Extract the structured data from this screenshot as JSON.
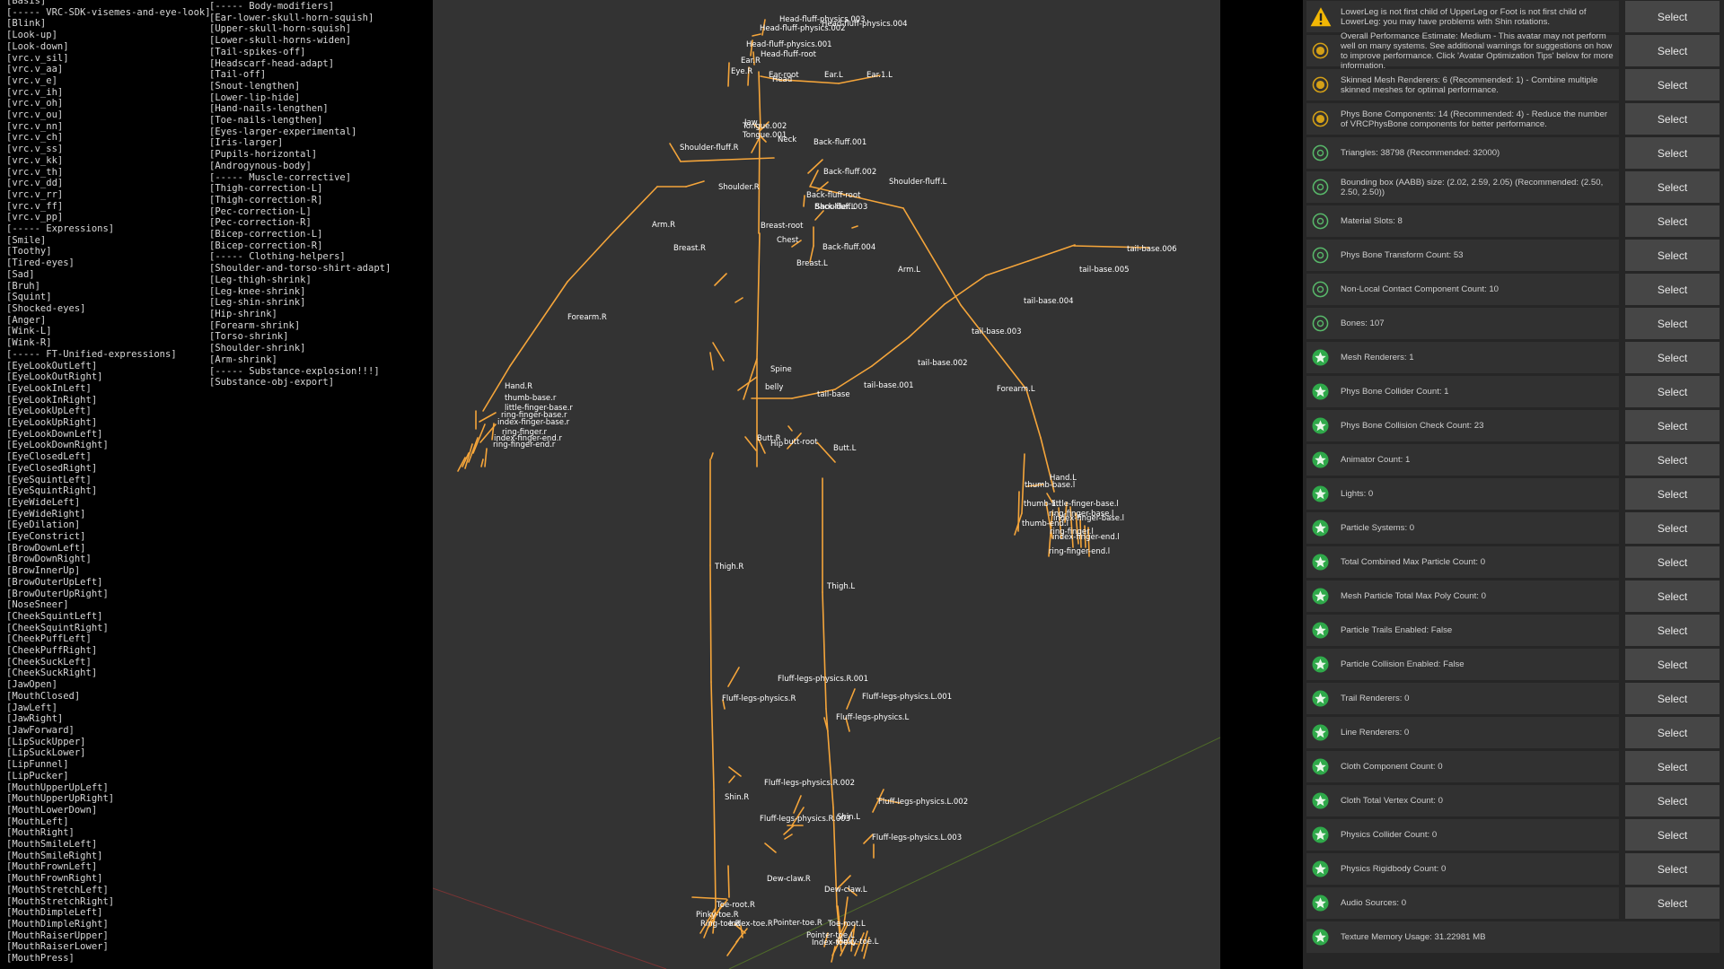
{
  "colors": {
    "bone": "#f5a53a",
    "viewport_bg": "#333333",
    "panel_bg": "#262626",
    "row_bg": "#313131",
    "button_bg": "#464646",
    "warning": "#f2b705",
    "info": "#d4a017",
    "ok": "#58b86a",
    "good": "#2fa94a"
  },
  "shape_keys": {
    "column1": [
      "[Basis]",
      "[----- VRC-SDK-visemes-and-eye-look]",
      "[Blink]",
      "[Look-up]",
      "[Look-down]",
      "[vrc.v_sil]",
      "[vrc.v_aa]",
      "[vrc.v_e]",
      "[vrc.v_ih]",
      "[vrc.v_oh]",
      "[vrc.v_ou]",
      "[vrc.v_nn]",
      "[vrc.v_ch]",
      "[vrc.v_ss]",
      "[vrc.v_kk]",
      "[vrc.v_th]",
      "[vrc.v_dd]",
      "[vrc.v_rr]",
      "[vrc.v_ff]",
      "[vrc.v_pp]",
      "[----- Expressions]",
      "[Smile]",
      "[Toothy]",
      "[Tired-eyes]",
      "[Sad]",
      "[Bruh]",
      "[Squint]",
      "[Shocked-eyes]",
      "[Anger]",
      "[Wink-L]",
      "[Wink-R]",
      "[----- FT-Unified-expressions]",
      "[EyeLookOutLeft]",
      "[EyeLookOutRight]",
      "[EyeLookInLeft]",
      "[EyeLookInRight]",
      "[EyeLookUpLeft]",
      "[EyeLookUpRight]",
      "[EyeLookDownLeft]",
      "[EyeLookDownRight]",
      "[EyeClosedLeft]",
      "[EyeClosedRight]",
      "[EyeSquintLeft]",
      "[EyeSquintRight]",
      "[EyeWideLeft]",
      "[EyeWideRight]",
      "[EyeDilation]",
      "[EyeConstrict]",
      "[BrowDownLeft]",
      "[BrowDownRight]",
      "[BrowInnerUp]",
      "[BrowOuterUpLeft]",
      "[BrowOuterUpRight]",
      "[NoseSneer]",
      "[CheekSquintLeft]",
      "[CheekSquintRight]",
      "[CheekPuffLeft]",
      "[CheekPuffRight]",
      "[CheekSuckLeft]",
      "[CheekSuckRight]",
      "[JawOpen]",
      "[MouthClosed]",
      "[JawLeft]",
      "[JawRight]",
      "[JawForward]",
      "[LipSuckUpper]",
      "[LipSuckLower]",
      "[LipFunnel]",
      "[LipPucker]",
      "[MouthUpperUpLeft]",
      "[MouthUpperUpRight]",
      "[MouthLowerDown]",
      "[MouthLeft]",
      "[MouthRight]",
      "[MouthSmileLeft]",
      "[MouthSmileRight]",
      "[MouthFrownLeft]",
      "[MouthFrownRight]",
      "[MouthStretchLeft]",
      "[MouthStretchRight]",
      "[MouthDimpleLeft]",
      "[MouthDimpleRight]",
      "[MouthRaiserUpper]",
      "[MouthRaiserLower]",
      "[MouthPress]"
    ],
    "column2": [
      "[----- Body-modifiers]",
      "[Ear-lower-skull-horn-squish]",
      "[Upper-skull-horn-squish]",
      "[Lower-skull-horns-widen]",
      "[Tail-spikes-off]",
      "[Headscarf-head-adapt]",
      "[Tail-off]",
      "[Snout-lengthen]",
      "[Lower-lip-hide]",
      "[Hand-nails-lengthen]",
      "[Toe-nails-lengthen]",
      "[Eyes-larger-experimental]",
      "[Iris-larger]",
      "[Pupils-horizontal]",
      "[Androgynous-body]",
      "[----- Muscle-corrective]",
      "[Thigh-correction-L]",
      "[Thigh-correction-R]",
      "[Pec-correction-L]",
      "[Pec-correction-R]",
      "[Bicep-correction-L]",
      "[Bicep-correction-R]",
      "[----- Clothing-helpers]",
      "[Shoulder-and-torso-shirt-adapt]",
      "[Leg-thigh-shrink]",
      "[Leg-knee-shrink]",
      "[Leg-shin-shrink]",
      "[Hip-shrink]",
      "[Forearm-shrink]",
      "[Torso-shrink]",
      "[Shoulder-shrink]",
      "[Arm-shrink]",
      "[----- Substance-explosion!!!]",
      "[Substance-obj-export]"
    ]
  },
  "bone_labels": [
    "Head-fluff-physics.003",
    "Head-fluff-physics.004",
    "Head-fluff-physics.002",
    "Head-fluff-physics.001",
    "Head-fluff-root",
    "Ear.R",
    "Eye.R",
    "Ear-root",
    "Ear.L",
    "Ear.1.L",
    "Head",
    "Jaw",
    "Tongue.002",
    "Tongue.001",
    "Neck",
    "Shoulder-fluff.R",
    "Back-fluff.001",
    "Back-fluff.002",
    "Shoulder-fluff.L",
    "Shoulder.R",
    "Back-fluff-root",
    "Back-fluff.003",
    "Shoulder.L",
    "Arm.R",
    "Breast-root",
    "Chest",
    "Breast.R",
    "Back-fluff.004",
    "Breast.L",
    "Arm.L",
    "tail-base.006",
    "tail-base.005",
    "tail-base.004",
    "tail-base.003",
    "tail-base.002",
    "Forearm.R",
    "Spine",
    "tail-base.001",
    "belly",
    "tail-base",
    "Forearm.L",
    "Hand.R",
    "thumb-base.r",
    "little-finger-base.r",
    "ring-finger-base.r",
    "index-finger-base.r",
    "ring-finger.r",
    "index-finger-end.r",
    "ring-finger-end.r",
    "Butt.R",
    "Hip",
    "butt-root",
    "Butt.L",
    "Hand.L",
    "thumb-base.l",
    "thumb-1.l",
    "little-finger-base.l",
    "ring-finger-base.l",
    "thumb-end.l",
    "index-finger-base.l",
    "ring-finger.l",
    "index-finger-end.l",
    "ring-finger-end.l",
    "Thigh.R",
    "Thigh.L",
    "Fluff-legs-physics.R.001",
    "Fluff-legs-physics.L.001",
    "Fluff-legs-physics.R",
    "Fluff-legs-physics.L",
    "Fluff-legs-physics.R.002",
    "Shin.R",
    "Fluff-legs-physics.L.002",
    "Fluff-legs-physics.R.003",
    "Shin.L",
    "Fluff-legs-physics.L.003",
    "Dew-claw.R",
    "Dew-claw.L",
    "Toe-root.R",
    "Pinky-toe.R",
    "Ring-toe.R",
    "Index-toe.R",
    "Pointer-toe.R",
    "Toe-root.L",
    "Pointer-toe.L",
    "Index-toe.L",
    "Pinky-toe.L"
  ],
  "performance": {
    "select_label": "Select",
    "rows": [
      {
        "status": "warning",
        "icon": "warning-icon",
        "text": "LowerLeg is not first child of UpperLeg or Foot is not first child of LowerLeg: you may have problems with Shin rotations.",
        "button": true
      },
      {
        "status": "info",
        "icon": "info-circle-icon",
        "text": "Overall Performance Estimate: Medium - This avatar may not perform well on many systems. See additional warnings for suggestions on how to improve performance. Click 'Avatar Optimization Tips' below for more information.",
        "button": true
      },
      {
        "status": "info",
        "icon": "info-circle-icon",
        "text": "Skinned Mesh Renderers: 6 (Recommended: 1) - Combine multiple skinned meshes for optimal performance.",
        "button": true
      },
      {
        "status": "info",
        "icon": "info-circle-icon",
        "text": "Phys Bone Components: 14 (Recommended: 4) - Reduce the number of VRCPhysBone components for better performance.",
        "button": true
      },
      {
        "status": "ok",
        "icon": "ok-circle-icon",
        "text": "Triangles: 38798 (Recommended: 32000)",
        "button": true
      },
      {
        "status": "ok",
        "icon": "ok-circle-icon",
        "text": "Bounding box (AABB) size: (2.02, 2.59, 2.05) (Recommended: (2.50, 2.50, 2.50))",
        "button": true
      },
      {
        "status": "ok",
        "icon": "ok-circle-icon",
        "text": "Material Slots: 8",
        "button": true
      },
      {
        "status": "ok",
        "icon": "ok-circle-icon",
        "text": "Phys Bone Transform Count: 53",
        "button": true
      },
      {
        "status": "ok",
        "icon": "ok-circle-icon",
        "text": "Non-Local Contact Component Count: 10",
        "button": true
      },
      {
        "status": "ok",
        "icon": "ok-circle-icon",
        "text": "Bones: 107",
        "button": true
      },
      {
        "status": "good",
        "icon": "star-badge-icon",
        "text": "Mesh Renderers: 1",
        "button": true
      },
      {
        "status": "good",
        "icon": "star-badge-icon",
        "text": "Phys Bone Collider Count: 1",
        "button": true
      },
      {
        "status": "good",
        "icon": "star-badge-icon",
        "text": "Phys Bone Collision Check Count: 23",
        "button": true
      },
      {
        "status": "good",
        "icon": "star-badge-icon",
        "text": "Animator Count: 1",
        "button": true
      },
      {
        "status": "good",
        "icon": "star-badge-icon",
        "text": "Lights: 0",
        "button": true
      },
      {
        "status": "good",
        "icon": "star-badge-icon",
        "text": "Particle Systems: 0",
        "button": true
      },
      {
        "status": "good",
        "icon": "star-badge-icon",
        "text": "Total Combined Max Particle Count: 0",
        "button": true
      },
      {
        "status": "good",
        "icon": "star-badge-icon",
        "text": "Mesh Particle Total Max Poly Count: 0",
        "button": true
      },
      {
        "status": "good",
        "icon": "star-badge-icon",
        "text": "Particle Trails Enabled: False",
        "button": true
      },
      {
        "status": "good",
        "icon": "star-badge-icon",
        "text": "Particle Collision Enabled: False",
        "button": true
      },
      {
        "status": "good",
        "icon": "star-badge-icon",
        "text": "Trail Renderers: 0",
        "button": true
      },
      {
        "status": "good",
        "icon": "star-badge-icon",
        "text": "Line Renderers: 0",
        "button": true
      },
      {
        "status": "good",
        "icon": "star-badge-icon",
        "text": "Cloth Component Count: 0",
        "button": true
      },
      {
        "status": "good",
        "icon": "star-badge-icon",
        "text": "Cloth Total Vertex Count: 0",
        "button": true
      },
      {
        "status": "good",
        "icon": "star-badge-icon",
        "text": "Physics Collider Count: 0",
        "button": true
      },
      {
        "status": "good",
        "icon": "star-badge-icon",
        "text": "Physics Rigidbody Count: 0",
        "button": true
      },
      {
        "status": "good",
        "icon": "star-badge-icon",
        "text": "Audio Sources: 0",
        "button": true
      },
      {
        "status": "good",
        "icon": "star-badge-icon",
        "text": "Texture Memory Usage: 31.22981 MB",
        "button": false
      }
    ]
  }
}
